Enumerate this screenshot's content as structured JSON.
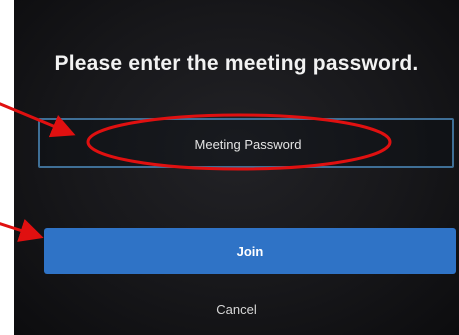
{
  "dialog": {
    "title": "Please enter the meeting password.",
    "password_placeholder": "Meeting Password",
    "join_label": "Join",
    "cancel_label": "Cancel"
  },
  "colors": {
    "background": "#1a1a1d",
    "join_button": "#2f73c6",
    "field_border": "#3f6f96",
    "annotation": "#e01010"
  }
}
